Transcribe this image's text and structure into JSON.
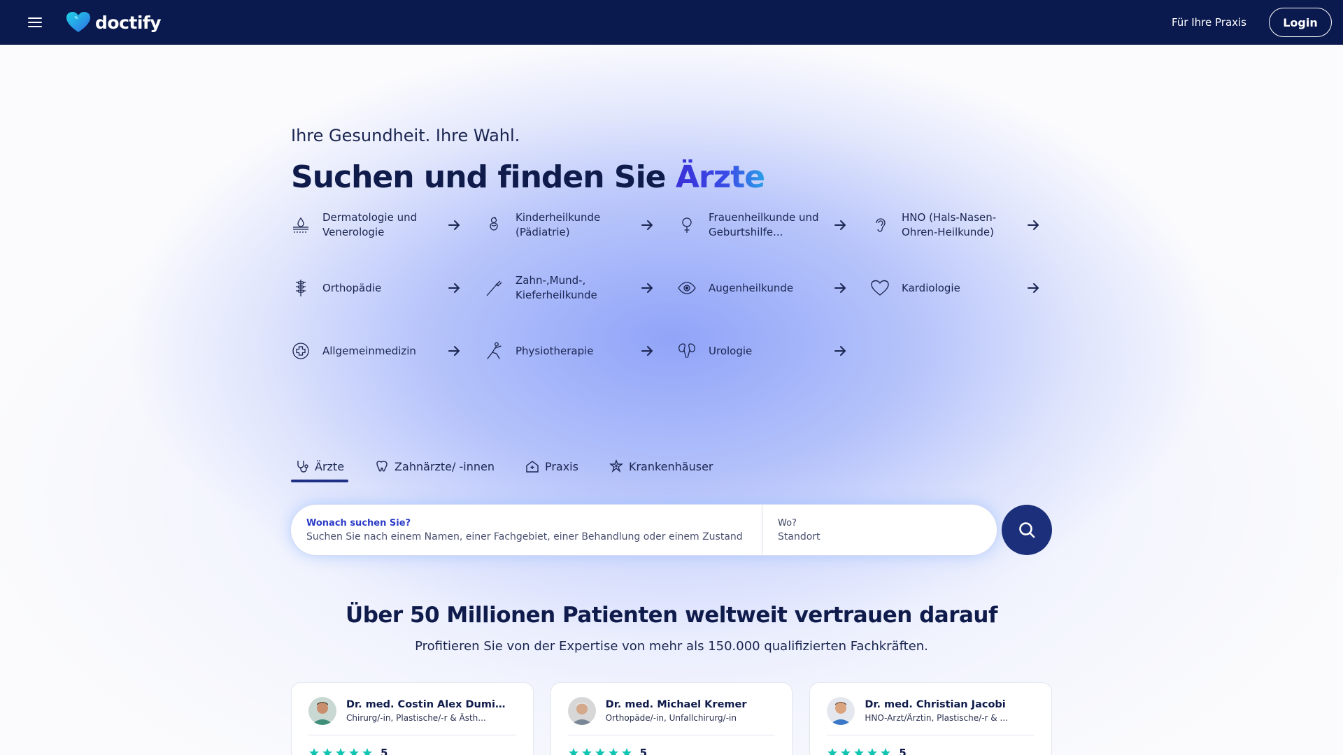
{
  "header": {
    "logo_text": "doctify",
    "praxis_link": "Für Ihre Praxis",
    "login_label": "Login"
  },
  "hero": {
    "tagline": "Ihre Gesundheit. Ihre Wahl.",
    "headline_prefix": "Suchen und finden Sie ",
    "headline_accent": "Ärzte"
  },
  "specialties": [
    {
      "label": "Dermatologie und Venerologie",
      "icon": "skin-icon"
    },
    {
      "label": "Kinderheilkunde (Pädiatrie)",
      "icon": "baby-icon"
    },
    {
      "label": "Frauenheilkunde und Geburtshilfe...",
      "icon": "female-icon"
    },
    {
      "label": "HNO (Hals-Nasen-Ohren-Heilkunde)",
      "icon": "ear-icon"
    },
    {
      "label": "Orthopädie",
      "icon": "spine-icon"
    },
    {
      "label": "Zahn-,Mund-, Kieferheilkunde",
      "icon": "dental-tool-icon"
    },
    {
      "label": "Augenheilkunde",
      "icon": "eye-icon"
    },
    {
      "label": "Kardiologie",
      "icon": "heart-icon"
    },
    {
      "label": "Allgemeinmedizin",
      "icon": "medical-cross-icon"
    },
    {
      "label": "Physiotherapie",
      "icon": "stretching-icon"
    },
    {
      "label": "Urologie",
      "icon": "kidneys-icon"
    }
  ],
  "tabs": [
    {
      "label": "Ärzte",
      "icon": "stethoscope-icon",
      "active": true
    },
    {
      "label": "Zahnärzte/ -innen",
      "icon": "tooth-icon",
      "active": false
    },
    {
      "label": "Praxis",
      "icon": "clinic-icon",
      "active": false
    },
    {
      "label": "Krankenhäuser",
      "icon": "hospital-icon",
      "active": false
    }
  ],
  "search": {
    "what_label": "Wonach suchen Sie?",
    "what_placeholder": "Suchen Sie nach einem Namen, einer Fachgebiet, einer Behandlung oder einem Zustand",
    "where_label": "Wo?",
    "where_placeholder": "Standort"
  },
  "trust": {
    "title": "Über 50 Millionen Patienten weltweit vertrauen darauf",
    "subtitle": "Profitieren Sie von der Expertise von mehr als 150.000 qualifizierten Fachkräften."
  },
  "doctors": [
    {
      "name": "Dr. med. Costin Alex Dumitres...",
      "specialty": "Chirurg/-in, Plastische/-r & Ästh...",
      "rating": "5"
    },
    {
      "name": "Dr. med. Michael Kremer",
      "specialty": "Orthopäde/-in, Unfallchirurg/-in",
      "rating": "5"
    },
    {
      "name": "Dr. med. Christian Jacobi",
      "specialty": "HNO-Arzt/Ärztin, Plastische/-r & ...",
      "rating": "5"
    }
  ],
  "colors": {
    "header_bg": "#0b1a4e",
    "accent": "#3a2fd8",
    "search_button": "#1c2f7a",
    "star": "#12c4b2"
  }
}
